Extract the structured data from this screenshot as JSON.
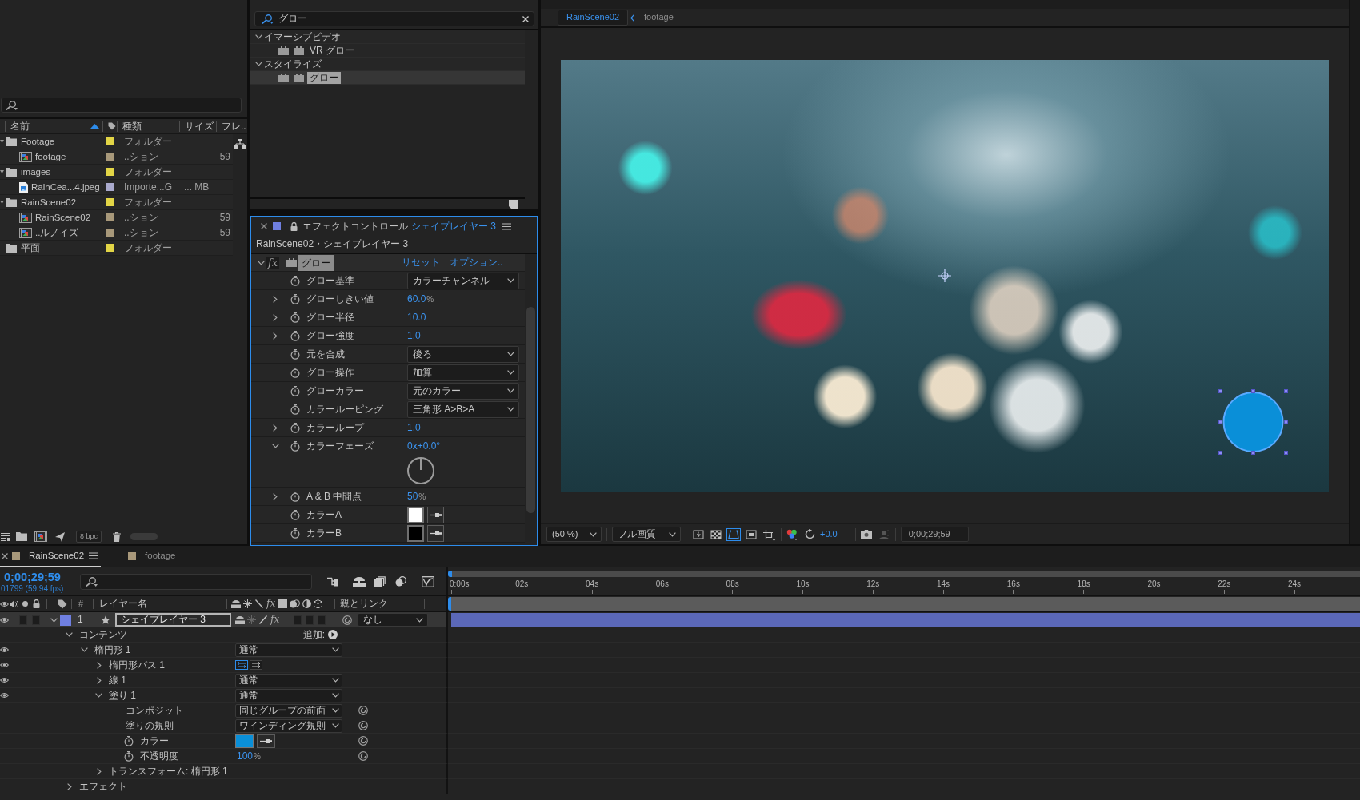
{
  "project": {
    "columns": [
      {
        "label": "名前",
        "sorted": true
      },
      {
        "label": "種類",
        "sorted": false
      },
      {
        "label": "サイズ",
        "sorted": false
      },
      {
        "label": "フレ..",
        "sorted": false
      }
    ],
    "items": [
      {
        "kind": "folder",
        "name": "Footage",
        "type": "フォルダー",
        "color": "#e2d546",
        "expanded": true,
        "children": [
          {
            "kind": "comp",
            "name": "footage",
            "type": "..ション",
            "color": "#a8987a",
            "frames": "59"
          }
        ]
      },
      {
        "kind": "folder",
        "name": "images",
        "type": "フォルダー",
        "color": "#e2d546",
        "expanded": true,
        "children": [
          {
            "kind": "image",
            "name": "RainCea...4.jpeg",
            "type": "Importe...G",
            "color": "#a9a9cc",
            "size": "... MB"
          }
        ]
      },
      {
        "kind": "folder",
        "name": "RainScene02",
        "type": "フォルダー",
        "color": "#e2d546",
        "expanded": true,
        "children": [
          {
            "kind": "comp",
            "name": "RainScene02",
            "type": "..ション",
            "color": "#a8987a",
            "frames": "59"
          },
          {
            "kind": "comp",
            "name": "..ルノイズ",
            "type": "..ション",
            "color": "#a8987a",
            "frames": "59"
          }
        ]
      },
      {
        "kind": "folder",
        "name": "平面",
        "type": "フォルダー",
        "color": "#e2d546"
      }
    ],
    "bit_depth": "8 bpc"
  },
  "effects_presets": {
    "search": {
      "value": "グロー"
    },
    "tree": [
      {
        "name": "イマーシブビデオ",
        "expanded": true,
        "children": [
          {
            "name": "VR グロー",
            "selected": false
          }
        ]
      },
      {
        "name": "スタイライズ",
        "expanded": true,
        "children": [
          {
            "name": "グロー",
            "selected": true
          }
        ]
      }
    ]
  },
  "effect_controls": {
    "title": "エフェクトコントロール",
    "layer": "シェイプレイヤー 3",
    "path": "RainScene02・シェイプレイヤー 3",
    "effect": {
      "fx": "fx",
      "enabled": true,
      "name": "グロー",
      "expanded": true,
      "selected": true,
      "reset": "リセット",
      "options": "オプション.."
    },
    "properties": [
      {
        "kind": "dropdown",
        "label": "グロー基準",
        "value": "カラーチャンネル"
      },
      {
        "kind": "number",
        "label": "グローしきい値",
        "expanded": false,
        "value": "60.0",
        "unit": "%"
      },
      {
        "kind": "number",
        "label": "グロー半径",
        "expanded": false,
        "value": "10.0"
      },
      {
        "kind": "number",
        "label": "グロー強度",
        "expanded": false,
        "value": "1.0"
      },
      {
        "kind": "dropdown",
        "label": "元を合成",
        "value": "後ろ"
      },
      {
        "kind": "dropdown",
        "label": "グロー操作",
        "value": "加算"
      },
      {
        "kind": "dropdown",
        "label": "グローカラー",
        "value": "元のカラー"
      },
      {
        "kind": "dropdown",
        "label": "カラールーピング",
        "value": "三角形 A>B>A"
      },
      {
        "kind": "number",
        "label": "カラーループ",
        "expanded": false,
        "value": "1.0"
      },
      {
        "kind": "angle",
        "label": "カラーフェーズ",
        "expanded": true,
        "value": "0x+0.0°"
      },
      {
        "kind": "number",
        "label": "A & B 中間点",
        "expanded": false,
        "value": "50",
        "unit": "%"
      },
      {
        "kind": "color",
        "label": "カラーA",
        "color": "#ffffff"
      },
      {
        "kind": "color",
        "label": "カラーB",
        "color": "#000000"
      }
    ]
  },
  "composition": {
    "breadcrumbs": [
      {
        "label": "RainScene02",
        "selected": true
      },
      {
        "label": "footage",
        "selected": false
      }
    ],
    "shape": {
      "selected": true
    },
    "toolbar": {
      "zoom": "(50 %)",
      "quality": "フル画質",
      "view_buttons": [
        {
          "kind": "preview",
          "selected": false
        },
        {
          "kind": "grid",
          "selected": false
        },
        {
          "kind": "mask",
          "selected": true
        },
        {
          "kind": "region",
          "selected": false
        },
        {
          "kind": "guides",
          "selected": false
        }
      ],
      "exposure": "+0.0",
      "timecode": "0;00;29;59"
    }
  },
  "timeline": {
    "tabs": [
      {
        "label": "RainScene02",
        "color": "#a8987a",
        "selected": true
      },
      {
        "label": "footage",
        "color": "#a8987a",
        "selected": false
      }
    ],
    "timecode": "0;00;29;59",
    "frame_info": "01799 (59.94 fps)",
    "header": {
      "number": "#",
      "layer_name": "レイヤー名",
      "fx": "fx",
      "parent": "親とリンク"
    },
    "layers": [
      {
        "number": "1",
        "name": "シェイプレイヤー 3",
        "color": "#6f7fe0",
        "visible": true,
        "selected": true,
        "expanded": true,
        "fx": "fx",
        "fx_on": true,
        "parent": "なし",
        "contents": [
          {
            "kind": "group",
            "label": "コンテンツ",
            "expanded": true,
            "add": "追加:",
            "children": [
              {
                "kind": "shape",
                "label": "楕円形 1",
                "visible": true,
                "expanded": true,
                "mode": "通常",
                "children": [
                  {
                    "kind": "path",
                    "label": "楕円形パス 1",
                    "visible": true,
                    "expanded": false
                  },
                  {
                    "kind": "shape",
                    "label": "線 1",
                    "visible": true,
                    "expanded": false,
                    "mode": "通常"
                  },
                  {
                    "kind": "shape",
                    "label": "塗り 1",
                    "visible": true,
                    "expanded": true,
                    "mode": "通常",
                    "children": [
                      {
                        "kind": "dropdown",
                        "label": "コンポジット",
                        "value": "同じグループの前面"
                      },
                      {
                        "kind": "dropdown",
                        "label": "塗りの規則",
                        "value": "ワインディング規則"
                      },
                      {
                        "kind": "color",
                        "label": "カラー",
                        "color": "#0a8fd8"
                      },
                      {
                        "kind": "number",
                        "label": "不透明度",
                        "value": "100",
                        "unit": "%"
                      }
                    ]
                  },
                  {
                    "kind": "group",
                    "label": "トランスフォーム: 楕円形 1",
                    "expanded": false
                  }
                ]
              }
            ]
          },
          {
            "kind": "group",
            "label": "エフェクト",
            "expanded": false
          }
        ]
      }
    ],
    "ruler": [
      "0:00s",
      "02s",
      "04s",
      "06s",
      "08s",
      "10s",
      "12s",
      "14s",
      "16s",
      "18s",
      "20s",
      "22s",
      "24s"
    ]
  }
}
